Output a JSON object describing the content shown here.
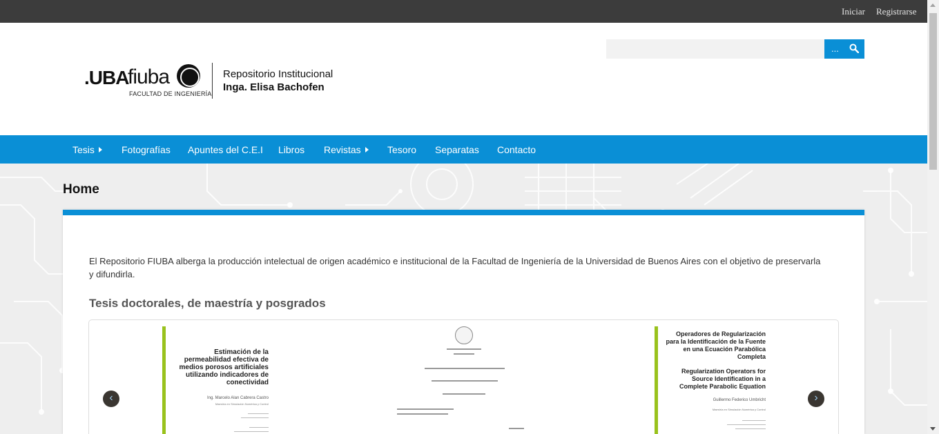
{
  "topbar": {
    "login": "Iniciar",
    "register": "Registrarse"
  },
  "logo": {
    "uba": ".UBA",
    "fiuba": "fiuba",
    "facultad": "FACULTAD DE INGENIERÍA",
    "repo_line1": "Repositorio Institucional",
    "repo_line2": "Inga. Elisa Bachofen"
  },
  "search": {
    "value": "",
    "button_label": "..."
  },
  "nav": {
    "items": [
      {
        "label": "Tesis",
        "has_submenu": true
      },
      {
        "label": "Fotografías",
        "has_submenu": false
      },
      {
        "label": "Apuntes del C.E.I",
        "has_submenu": false
      },
      {
        "label": "Libros",
        "has_submenu": false
      },
      {
        "label": "Revistas",
        "has_submenu": true
      },
      {
        "label": "Tesoro",
        "has_submenu": false
      },
      {
        "label": "Separatas",
        "has_submenu": false
      },
      {
        "label": "Contacto",
        "has_submenu": false
      }
    ]
  },
  "page": {
    "title": "Home",
    "intro": "El Repositorio FIUBA alberga la producción intelectual de origen académico e institucional de la Facultad de Ingeniería de la Universidad de Buenos Aires con el objetivo de preservarla y difundirla.",
    "section_title": "Tesis doctorales, de maestría y posgrados"
  },
  "carousel": {
    "prev_label": "‹",
    "next_label": "›",
    "slides": [
      {
        "title": "Estimación de la permeabilidad efectiva de medios porosos artificiales utilizando indicadores de conectividad",
        "author": "Ing. Marcelo Alan Cabrera Castro",
        "program": "Maestría en Simulación Numérica y Control"
      },
      {},
      {
        "title_es": "Operadores de Regularización para la Identificación de la Fuente en una Ecuación Parabólica Completa",
        "title_en": "Regularization Operators for Source Identification in a Complete Parabolic Equation",
        "author": "Guillermo Federico Umbricht",
        "program": "Maestría en Simulación Numérica y Control"
      }
    ]
  },
  "colors": {
    "accent": "#0a8fd6",
    "topbar": "#3c3c3c",
    "thesis_bar": "#99c21d"
  },
  "icons": {
    "search": "search-icon",
    "prev": "chevron-left-icon",
    "next": "chevron-right-icon",
    "caret": "caret-right-icon"
  }
}
